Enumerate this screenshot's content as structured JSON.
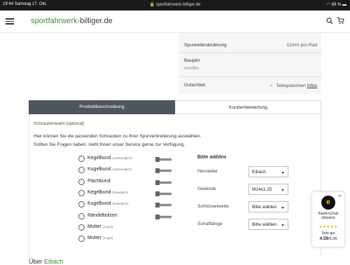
{
  "status_bar": {
    "time": "19:44",
    "date": "Samstag 17. Okt.",
    "url": "sportfahrwerk-billiger.de",
    "battery": "69 %"
  },
  "header": {
    "logo_green": "sportfahrwerk",
    "logo_dark": "-billiger.de"
  },
  "specs": {
    "rows": [
      {
        "label": "Spurweitenänderung",
        "value": "12mm pro Rad"
      },
      {
        "label": "Baujahr",
        "sub": "von/bis"
      },
      {
        "label": "Gutachten",
        "value": "Teilegutachten",
        "link": "Infos"
      }
    ]
  },
  "tabs": [
    {
      "label": "Produktbeschreibung",
      "active": true
    },
    {
      "label": "Kundenbewertung",
      "active": false
    }
  ],
  "content": {
    "section_title": "Schraubenwahl (optional)",
    "intro_line1": "Hier können Sie die passenden Schrauben zu Ihrer Spurverbreiterung auswählen.",
    "intro_line2": "Sollten Sie Fragen haben, steht Ihnen unser Service gerne zur Verfügung.",
    "options": [
      {
        "label": "Kegelbund",
        "hint": "(unbeweglich)",
        "bolt": true
      },
      {
        "label": "Kugelbund",
        "hint": "(unbeweglich)",
        "bolt": true
      },
      {
        "label": "Flachbund",
        "hint": "",
        "bolt": true
      },
      {
        "label": "Kegelbund",
        "hint": "(beweglich)",
        "bolt": true
      },
      {
        "label": "Kugelbund",
        "hint": "(beweglich)",
        "bolt": true
      },
      {
        "label": "Rändelbolzen",
        "hint": "",
        "bolt": true
      },
      {
        "label": "Mutter",
        "hint": "(Kegel)",
        "bolt": false
      },
      {
        "label": "Mutter",
        "hint": "(Kugel)",
        "bolt": false
      }
    ],
    "pick_title": "Bitte wählen",
    "selects": [
      {
        "label": "Hersteller",
        "value": "Eibach"
      },
      {
        "label": "Gewinde",
        "value": "M14x1,25"
      },
      {
        "label": "Schlüsselweite",
        "value": "Bitte wählen"
      },
      {
        "label": "Schaftlänge",
        "value": "Bitte wählen"
      }
    ]
  },
  "badge": {
    "line1": "Käuferschutz",
    "line2": "inklusive",
    "rating_word": "Sehr gut",
    "rating_value": "4.59",
    "rating_max": "/5.00"
  },
  "about": {
    "prefix": "Über",
    "brand": "Eibach"
  },
  "colors": {
    "brand_green": "#3c8f2f",
    "tab_active": "#4d5560"
  }
}
